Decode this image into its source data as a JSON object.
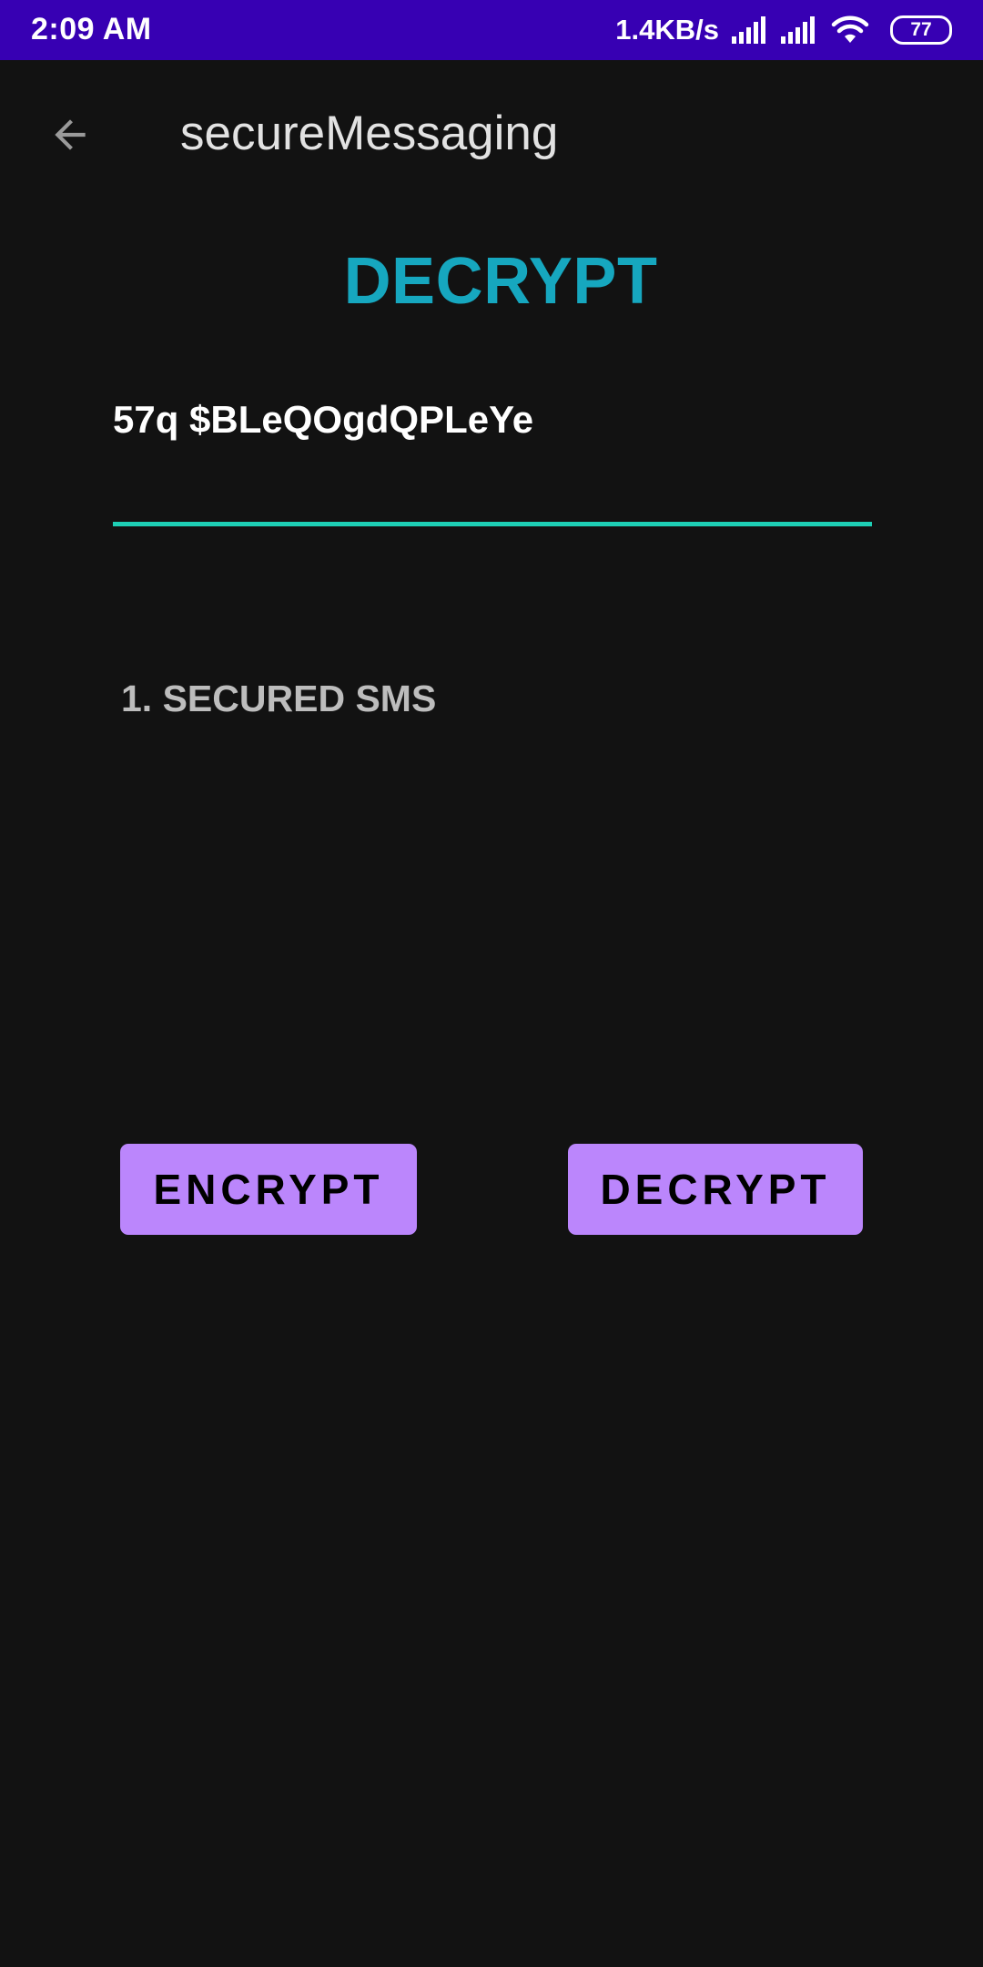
{
  "status_bar": {
    "time": "2:09 AM",
    "net_speed": "1.4KB/s",
    "battery": "77",
    "icons": [
      "signal-icon",
      "signal-icon",
      "wifi-icon",
      "battery-icon"
    ]
  },
  "app_bar": {
    "title": "secureMessaging",
    "back_icon": "arrow-back-icon"
  },
  "screen": {
    "heading": "DECRYPT",
    "message_input": {
      "value": "57q $BLeQOgdQPLeYe",
      "placeholder": ""
    },
    "sms_list": [
      "1. SECURED SMS"
    ]
  },
  "actions": {
    "encrypt_label": "ENCRYPT",
    "decrypt_label": "DECRYPT"
  },
  "colors": {
    "status_bar": "#3700b3",
    "background": "#121212",
    "heading": "#16a7bf",
    "input_underline": "#1ecfb5",
    "button": "#bb86fc"
  }
}
